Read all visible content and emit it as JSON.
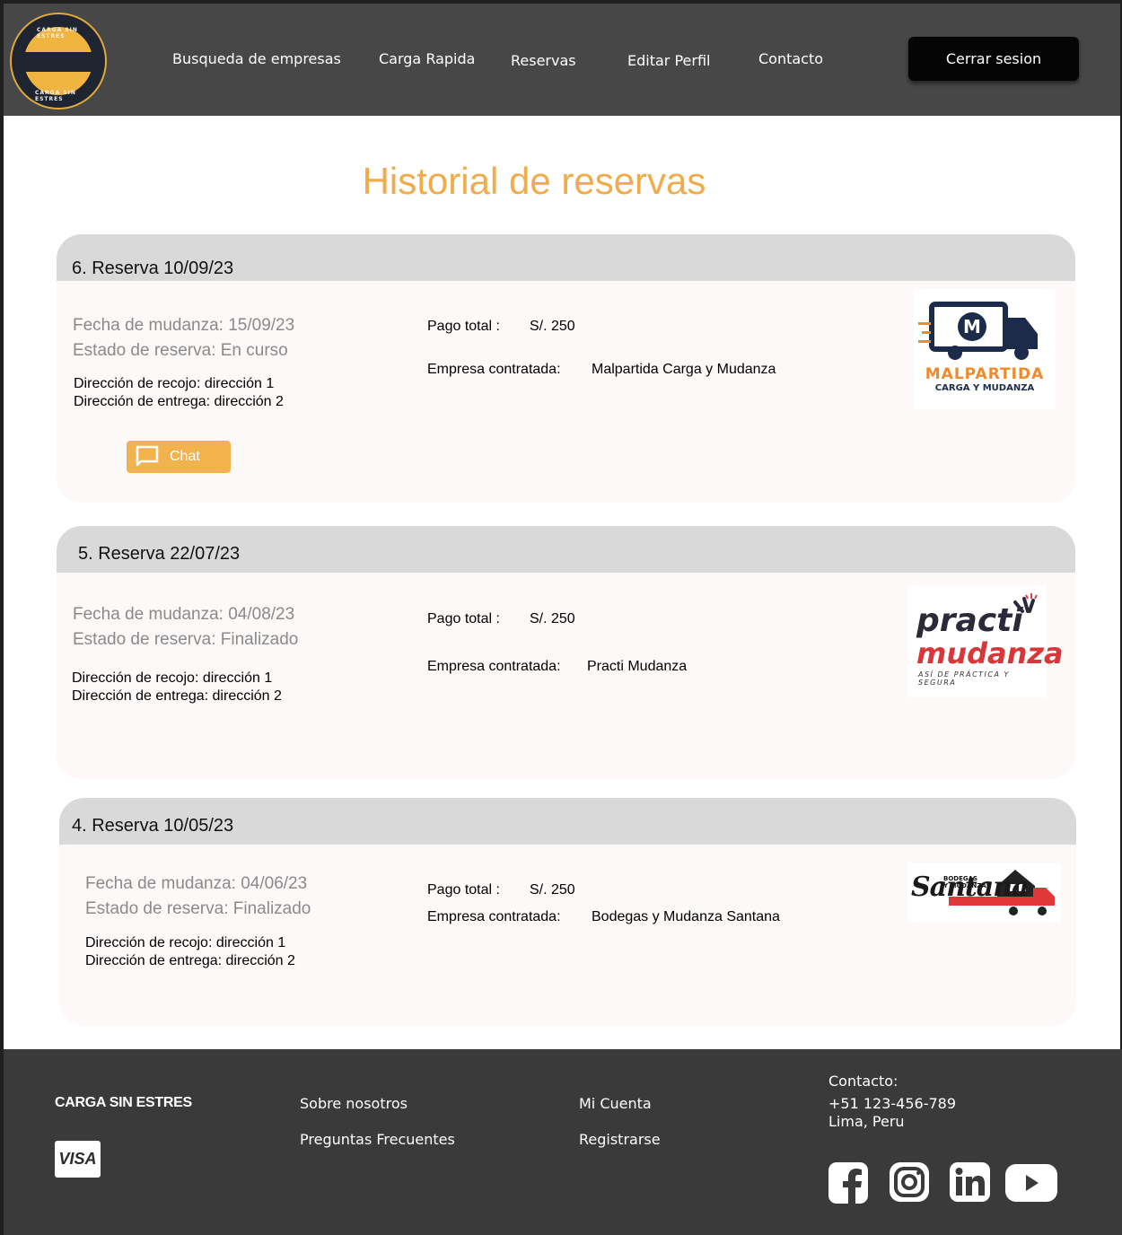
{
  "header": {
    "logo_text_top": "CARGA SIN ESTRES",
    "logo_text_bottom": "CARGA SIN ESTRES",
    "nav": [
      "Busqueda de empresas",
      "Carga Rapida",
      "Reservas",
      "Editar Perfil",
      "Contacto"
    ],
    "logout_label": "Cerrar sesion"
  },
  "page_title": "Historial de reservas",
  "labels": {
    "pago_total": "Pago total :",
    "empresa_contratada": "Empresa contratada:",
    "chat": "Chat"
  },
  "reservations": [
    {
      "title": "6. Reserva 10/09/23",
      "fecha": "Fecha de mudanza: 15/09/23",
      "estado": "Estado de reserva: En curso",
      "recojo": "Dirección de recojo: dirección 1",
      "entrega": "Dirección de entrega: dirección 2",
      "pago": "S/. 250",
      "empresa": "Malpartida Carga y Mudanza",
      "logo_line1": "MALPARTIDA",
      "logo_line2": "CARGA Y MUDANZA"
    },
    {
      "title": "5. Reserva 22/07/23",
      "fecha": "Fecha de mudanza: 04/08/23",
      "estado": "Estado de reserva: Finalizado",
      "recojo": "Dirección de recojo: dirección 1",
      "entrega": "Dirección de entrega: dirección 2",
      "pago": "S/. 250",
      "empresa": "Practi Mudanza",
      "logo_line1": "practi",
      "logo_line2": "mudanza",
      "logo_line3": "ASÍ DE PRÁCTICA Y SEGURA"
    },
    {
      "title": "4. Reserva 10/05/23",
      "fecha": "Fecha de mudanza: 04/06/23",
      "estado": "Estado de reserva: Finalizado",
      "recojo": "Dirección de recojo: dirección 1",
      "entrega": "Dirección de entrega: dirección 2",
      "pago": "S/. 250",
      "empresa": "Bodegas y Mudanza Santana",
      "logo_line1": "BODEGAS",
      "logo_line2": "Y MUDANZAS",
      "logo_line3": "Santana"
    }
  ],
  "footer": {
    "brand": "CARGA SIN ESTRES",
    "visa": "VISA",
    "sobre": "Sobre nosotros",
    "preguntas": "Preguntas Frecuentes",
    "cuenta": "Mi Cuenta",
    "registrarse": "Registrarse",
    "contacto_label": "Contacto:",
    "phone": "+51 123-456-789",
    "city": "Lima, Peru",
    "social_icons": [
      "facebook-icon",
      "instagram-icon",
      "linkedin-icon",
      "youtube-icon"
    ]
  }
}
